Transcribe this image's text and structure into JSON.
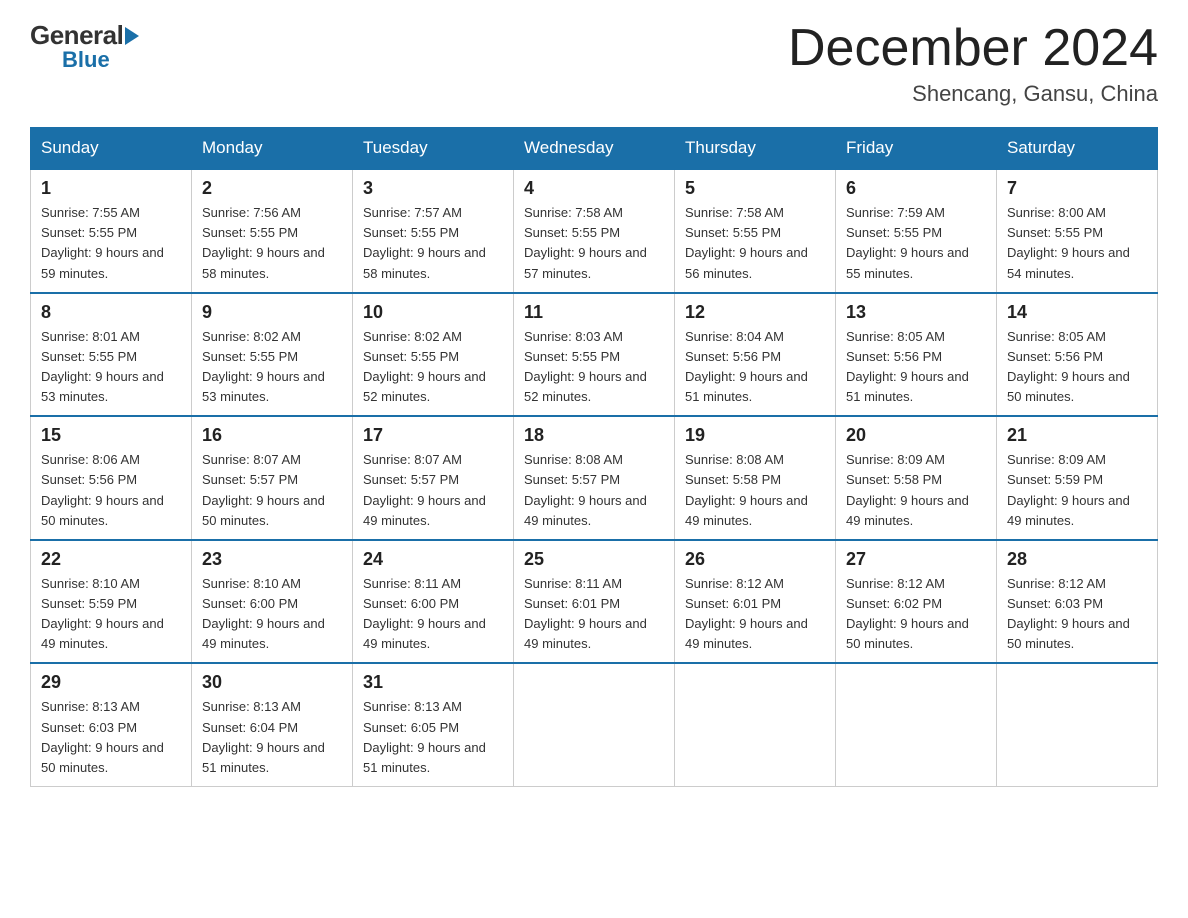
{
  "header": {
    "logo_general": "General",
    "logo_blue": "Blue",
    "month_title": "December 2024",
    "location": "Shencang, Gansu, China"
  },
  "days_of_week": [
    "Sunday",
    "Monday",
    "Tuesday",
    "Wednesday",
    "Thursday",
    "Friday",
    "Saturday"
  ],
  "weeks": [
    [
      {
        "day": "1",
        "sunrise": "Sunrise: 7:55 AM",
        "sunset": "Sunset: 5:55 PM",
        "daylight": "Daylight: 9 hours and 59 minutes."
      },
      {
        "day": "2",
        "sunrise": "Sunrise: 7:56 AM",
        "sunset": "Sunset: 5:55 PM",
        "daylight": "Daylight: 9 hours and 58 minutes."
      },
      {
        "day": "3",
        "sunrise": "Sunrise: 7:57 AM",
        "sunset": "Sunset: 5:55 PM",
        "daylight": "Daylight: 9 hours and 58 minutes."
      },
      {
        "day": "4",
        "sunrise": "Sunrise: 7:58 AM",
        "sunset": "Sunset: 5:55 PM",
        "daylight": "Daylight: 9 hours and 57 minutes."
      },
      {
        "day": "5",
        "sunrise": "Sunrise: 7:58 AM",
        "sunset": "Sunset: 5:55 PM",
        "daylight": "Daylight: 9 hours and 56 minutes."
      },
      {
        "day": "6",
        "sunrise": "Sunrise: 7:59 AM",
        "sunset": "Sunset: 5:55 PM",
        "daylight": "Daylight: 9 hours and 55 minutes."
      },
      {
        "day": "7",
        "sunrise": "Sunrise: 8:00 AM",
        "sunset": "Sunset: 5:55 PM",
        "daylight": "Daylight: 9 hours and 54 minutes."
      }
    ],
    [
      {
        "day": "8",
        "sunrise": "Sunrise: 8:01 AM",
        "sunset": "Sunset: 5:55 PM",
        "daylight": "Daylight: 9 hours and 53 minutes."
      },
      {
        "day": "9",
        "sunrise": "Sunrise: 8:02 AM",
        "sunset": "Sunset: 5:55 PM",
        "daylight": "Daylight: 9 hours and 53 minutes."
      },
      {
        "day": "10",
        "sunrise": "Sunrise: 8:02 AM",
        "sunset": "Sunset: 5:55 PM",
        "daylight": "Daylight: 9 hours and 52 minutes."
      },
      {
        "day": "11",
        "sunrise": "Sunrise: 8:03 AM",
        "sunset": "Sunset: 5:55 PM",
        "daylight": "Daylight: 9 hours and 52 minutes."
      },
      {
        "day": "12",
        "sunrise": "Sunrise: 8:04 AM",
        "sunset": "Sunset: 5:56 PM",
        "daylight": "Daylight: 9 hours and 51 minutes."
      },
      {
        "day": "13",
        "sunrise": "Sunrise: 8:05 AM",
        "sunset": "Sunset: 5:56 PM",
        "daylight": "Daylight: 9 hours and 51 minutes."
      },
      {
        "day": "14",
        "sunrise": "Sunrise: 8:05 AM",
        "sunset": "Sunset: 5:56 PM",
        "daylight": "Daylight: 9 hours and 50 minutes."
      }
    ],
    [
      {
        "day": "15",
        "sunrise": "Sunrise: 8:06 AM",
        "sunset": "Sunset: 5:56 PM",
        "daylight": "Daylight: 9 hours and 50 minutes."
      },
      {
        "day": "16",
        "sunrise": "Sunrise: 8:07 AM",
        "sunset": "Sunset: 5:57 PM",
        "daylight": "Daylight: 9 hours and 50 minutes."
      },
      {
        "day": "17",
        "sunrise": "Sunrise: 8:07 AM",
        "sunset": "Sunset: 5:57 PM",
        "daylight": "Daylight: 9 hours and 49 minutes."
      },
      {
        "day": "18",
        "sunrise": "Sunrise: 8:08 AM",
        "sunset": "Sunset: 5:57 PM",
        "daylight": "Daylight: 9 hours and 49 minutes."
      },
      {
        "day": "19",
        "sunrise": "Sunrise: 8:08 AM",
        "sunset": "Sunset: 5:58 PM",
        "daylight": "Daylight: 9 hours and 49 minutes."
      },
      {
        "day": "20",
        "sunrise": "Sunrise: 8:09 AM",
        "sunset": "Sunset: 5:58 PM",
        "daylight": "Daylight: 9 hours and 49 minutes."
      },
      {
        "day": "21",
        "sunrise": "Sunrise: 8:09 AM",
        "sunset": "Sunset: 5:59 PM",
        "daylight": "Daylight: 9 hours and 49 minutes."
      }
    ],
    [
      {
        "day": "22",
        "sunrise": "Sunrise: 8:10 AM",
        "sunset": "Sunset: 5:59 PM",
        "daylight": "Daylight: 9 hours and 49 minutes."
      },
      {
        "day": "23",
        "sunrise": "Sunrise: 8:10 AM",
        "sunset": "Sunset: 6:00 PM",
        "daylight": "Daylight: 9 hours and 49 minutes."
      },
      {
        "day": "24",
        "sunrise": "Sunrise: 8:11 AM",
        "sunset": "Sunset: 6:00 PM",
        "daylight": "Daylight: 9 hours and 49 minutes."
      },
      {
        "day": "25",
        "sunrise": "Sunrise: 8:11 AM",
        "sunset": "Sunset: 6:01 PM",
        "daylight": "Daylight: 9 hours and 49 minutes."
      },
      {
        "day": "26",
        "sunrise": "Sunrise: 8:12 AM",
        "sunset": "Sunset: 6:01 PM",
        "daylight": "Daylight: 9 hours and 49 minutes."
      },
      {
        "day": "27",
        "sunrise": "Sunrise: 8:12 AM",
        "sunset": "Sunset: 6:02 PM",
        "daylight": "Daylight: 9 hours and 50 minutes."
      },
      {
        "day": "28",
        "sunrise": "Sunrise: 8:12 AM",
        "sunset": "Sunset: 6:03 PM",
        "daylight": "Daylight: 9 hours and 50 minutes."
      }
    ],
    [
      {
        "day": "29",
        "sunrise": "Sunrise: 8:13 AM",
        "sunset": "Sunset: 6:03 PM",
        "daylight": "Daylight: 9 hours and 50 minutes."
      },
      {
        "day": "30",
        "sunrise": "Sunrise: 8:13 AM",
        "sunset": "Sunset: 6:04 PM",
        "daylight": "Daylight: 9 hours and 51 minutes."
      },
      {
        "day": "31",
        "sunrise": "Sunrise: 8:13 AM",
        "sunset": "Sunset: 6:05 PM",
        "daylight": "Daylight: 9 hours and 51 minutes."
      },
      null,
      null,
      null,
      null
    ]
  ]
}
